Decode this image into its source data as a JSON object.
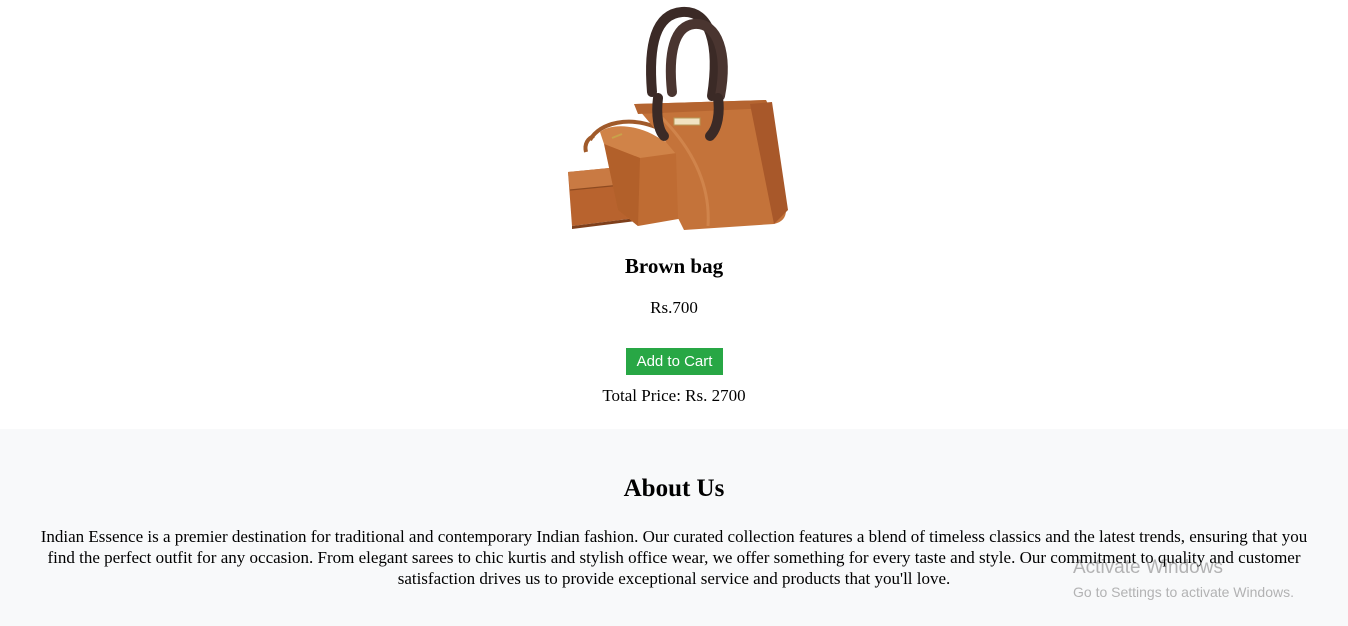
{
  "product": {
    "image_alt": "Brown bag",
    "name": "Brown bag",
    "price": "Rs.700",
    "add_to_cart_label": "Add to Cart",
    "total_price": "Total Price: Rs. 2700",
    "accent_color": "#28a745"
  },
  "about": {
    "title": "About Us",
    "text": "Indian Essence is a premier destination for traditional and contemporary Indian fashion. Our curated collection features a blend of timeless classics and the latest trends, ensuring that you find the perfect outfit for any occasion. From elegant sarees to chic kurtis and stylish office wear, we offer something for every taste and style. Our commitment to quality and customer satisfaction drives us to provide exceptional service and products that you'll love.",
    "background_color": "#f8f9fa"
  },
  "windows_watermark": {
    "title": "Activate Windows",
    "subtitle": "Go to Settings to activate Windows."
  }
}
